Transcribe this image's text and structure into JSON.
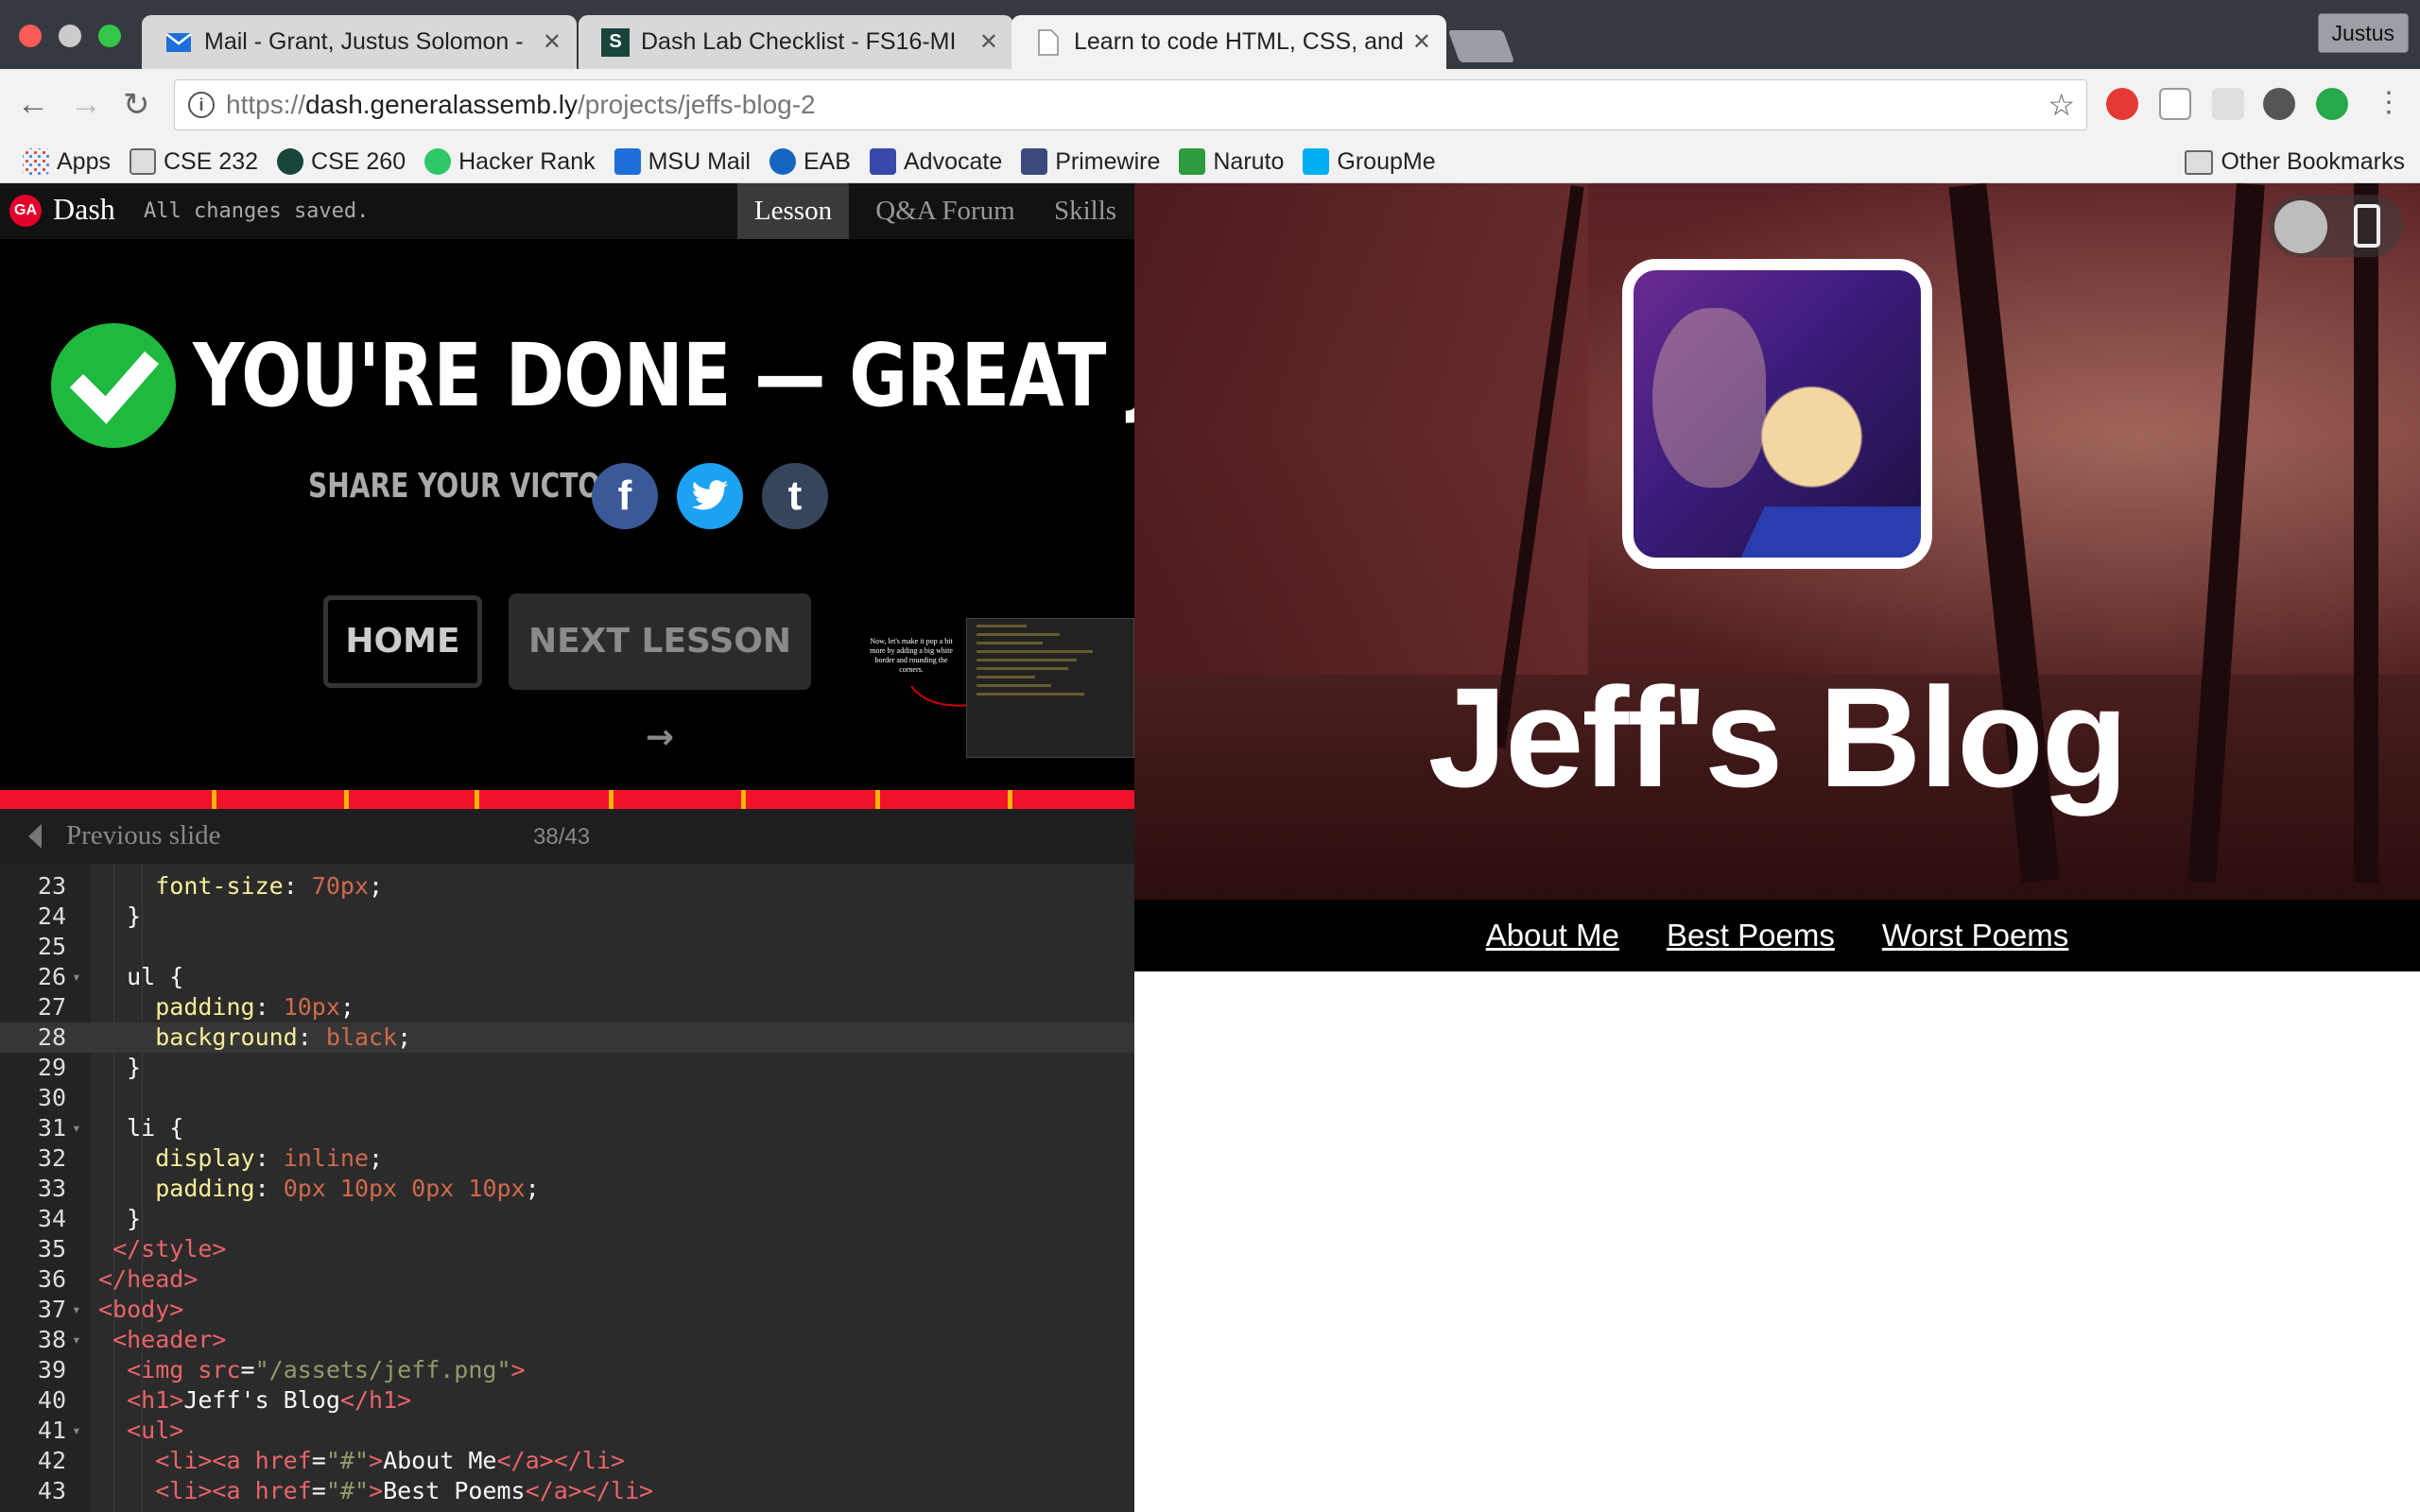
{
  "browser": {
    "tabs": [
      {
        "title": "Mail - Grant, Justus Solomon - ",
        "icon": "mail-icon"
      },
      {
        "title": "Dash Lab Checklist - FS16-MI",
        "icon": "spartan-s-icon"
      },
      {
        "title": "Learn to code HTML, CSS, and",
        "icon": "page-icon"
      }
    ],
    "profile": "Justus",
    "url_scheme": "https://",
    "url_host": "dash.generalassemb.ly",
    "url_path": "/projects/jeffs-blog-2",
    "bookmarks": [
      "Apps",
      "CSE 232",
      "CSE 260",
      "Hacker Rank",
      "MSU Mail",
      "EAB",
      "Advocate",
      "Primewire",
      "Naruto",
      "GroupMe"
    ],
    "other_bookmarks": "Other Bookmarks"
  },
  "lesson": {
    "logo": "GA",
    "app_name": "Dash",
    "save_status": "All changes saved.",
    "tabs": [
      "Lesson",
      "Q&A Forum",
      "Skills"
    ],
    "done_title": "YOU'RE DONE — GREAT JOB!",
    "share_label": "SHARE YOUR VICTORY:",
    "share": {
      "facebook": "f",
      "twitter": "twitter",
      "tumblr": "t"
    },
    "home_button": "HOME",
    "next_button": "NEXT LESSON →",
    "mini_note": "Now, let's make it pop a bit more by adding a big white border and rounding the corners.",
    "prev_slide": "Previous slide",
    "slide_counter": "38/43",
    "progress": 0.88
  },
  "editor": {
    "lines": [
      {
        "n": "23",
        "fold": false,
        "parts": [
          [
            "c-txt",
            "    "
          ],
          [
            "c-prop",
            "font-size"
          ],
          [
            "c-txt",
            ": "
          ],
          [
            "c-num",
            "70"
          ],
          [
            "c-kw",
            "px"
          ],
          [
            "c-txt",
            ";"
          ]
        ]
      },
      {
        "n": "24",
        "fold": false,
        "parts": [
          [
            "c-txt",
            "  }"
          ]
        ]
      },
      {
        "n": "25",
        "fold": false,
        "parts": [
          [
            "c-txt",
            ""
          ]
        ]
      },
      {
        "n": "26",
        "fold": true,
        "parts": [
          [
            "c-txt",
            "  ul {"
          ]
        ]
      },
      {
        "n": "27",
        "fold": false,
        "parts": [
          [
            "c-txt",
            "    "
          ],
          [
            "c-prop",
            "padding"
          ],
          [
            "c-txt",
            ": "
          ],
          [
            "c-num",
            "10"
          ],
          [
            "c-kw",
            "px"
          ],
          [
            "c-txt",
            ";"
          ]
        ]
      },
      {
        "n": "28",
        "fold": false,
        "hl": true,
        "parts": [
          [
            "c-txt",
            "    "
          ],
          [
            "c-prop",
            "background"
          ],
          [
            "c-txt",
            ": "
          ],
          [
            "c-kw",
            "black"
          ],
          [
            "c-txt",
            ";"
          ]
        ]
      },
      {
        "n": "29",
        "fold": false,
        "parts": [
          [
            "c-txt",
            "  }"
          ]
        ]
      },
      {
        "n": "30",
        "fold": false,
        "parts": [
          [
            "c-txt",
            ""
          ]
        ]
      },
      {
        "n": "31",
        "fold": true,
        "parts": [
          [
            "c-txt",
            "  li {"
          ]
        ]
      },
      {
        "n": "32",
        "fold": false,
        "parts": [
          [
            "c-txt",
            "    "
          ],
          [
            "c-prop",
            "display"
          ],
          [
            "c-txt",
            ": "
          ],
          [
            "c-kw",
            "inline"
          ],
          [
            "c-txt",
            ";"
          ]
        ]
      },
      {
        "n": "33",
        "fold": false,
        "parts": [
          [
            "c-txt",
            "    "
          ],
          [
            "c-prop",
            "padding"
          ],
          [
            "c-txt",
            ": "
          ],
          [
            "c-num",
            "0"
          ],
          [
            "c-kw",
            "px "
          ],
          [
            "c-num",
            "10"
          ],
          [
            "c-kw",
            "px "
          ],
          [
            "c-num",
            "0"
          ],
          [
            "c-kw",
            "px "
          ],
          [
            "c-num",
            "10"
          ],
          [
            "c-kw",
            "px"
          ],
          [
            "c-txt",
            ";"
          ]
        ]
      },
      {
        "n": "34",
        "fold": false,
        "parts": [
          [
            "c-txt",
            "  }"
          ]
        ]
      },
      {
        "n": "35",
        "fold": false,
        "parts": [
          [
            "c-txt",
            " "
          ],
          [
            "c-tag",
            "</style>"
          ]
        ]
      },
      {
        "n": "36",
        "fold": false,
        "parts": [
          [
            "c-tag",
            "</head>"
          ]
        ]
      },
      {
        "n": "37",
        "fold": true,
        "parts": [
          [
            "c-tag",
            "<body>"
          ]
        ]
      },
      {
        "n": "38",
        "fold": true,
        "parts": [
          [
            "c-txt",
            " "
          ],
          [
            "c-tag",
            "<header>"
          ]
        ]
      },
      {
        "n": "39",
        "fold": false,
        "parts": [
          [
            "c-txt",
            "  "
          ],
          [
            "c-tag",
            "<img "
          ],
          [
            "c-tag",
            "src"
          ],
          [
            "c-txt",
            "="
          ],
          [
            "c-str",
            "\"/assets/jeff.png\""
          ],
          [
            "c-tag",
            ">"
          ]
        ]
      },
      {
        "n": "40",
        "fold": false,
        "parts": [
          [
            "c-txt",
            "  "
          ],
          [
            "c-tag",
            "<h1>"
          ],
          [
            "c-txt",
            "Jeff's Blog"
          ],
          [
            "c-tag",
            "</h1>"
          ]
        ]
      },
      {
        "n": "41",
        "fold": true,
        "parts": [
          [
            "c-txt",
            "  "
          ],
          [
            "c-tag",
            "<ul>"
          ]
        ]
      },
      {
        "n": "42",
        "fold": false,
        "parts": [
          [
            "c-txt",
            "    "
          ],
          [
            "c-tag",
            "<li><a "
          ],
          [
            "c-tag",
            "href"
          ],
          [
            "c-txt",
            "="
          ],
          [
            "c-str",
            "\"#\""
          ],
          [
            "c-tag",
            ">"
          ],
          [
            "c-txt",
            "About Me"
          ],
          [
            "c-tag",
            "</a></li>"
          ]
        ]
      },
      {
        "n": "43",
        "fold": false,
        "parts": [
          [
            "c-txt",
            "    "
          ],
          [
            "c-tag",
            "<li><a "
          ],
          [
            "c-tag",
            "href"
          ],
          [
            "c-txt",
            "="
          ],
          [
            "c-str",
            "\"#\""
          ],
          [
            "c-tag",
            ">"
          ],
          [
            "c-txt",
            "Best Poems"
          ],
          [
            "c-tag",
            "</a></li>"
          ]
        ]
      }
    ]
  },
  "preview": {
    "blog_title": "Jeff's Blog",
    "nav": [
      "About Me",
      "Best Poems",
      "Worst Poems"
    ]
  }
}
